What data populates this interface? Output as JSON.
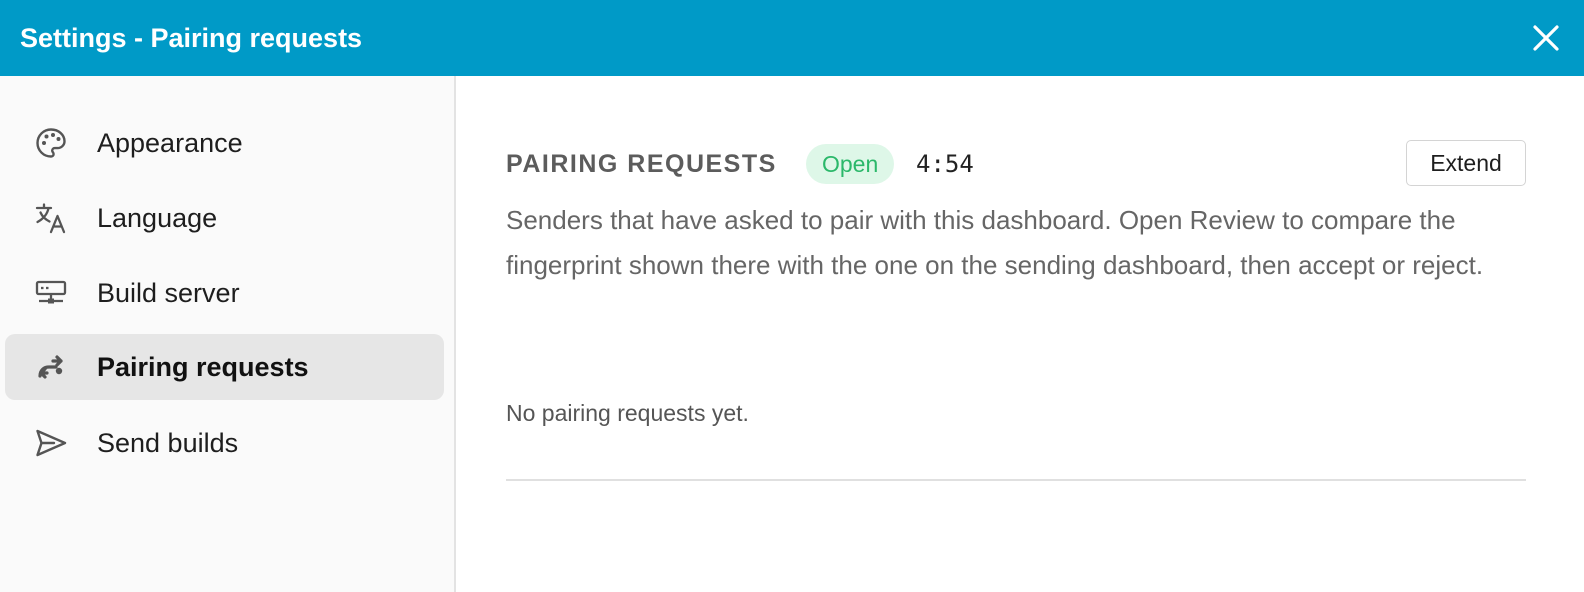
{
  "window": {
    "title": "Settings - Pairing requests",
    "close_icon": "close-icon",
    "titlebar_color": "#009ac7"
  },
  "sidebar": {
    "items": [
      {
        "id": "appearance",
        "label": "Appearance",
        "icon": "palette-icon",
        "active": false
      },
      {
        "id": "language",
        "label": "Language",
        "icon": "translate-icon",
        "active": false
      },
      {
        "id": "build-server",
        "label": "Build server",
        "icon": "server-icon",
        "active": false
      },
      {
        "id": "pairing-requests",
        "label": "Pairing requests",
        "icon": "pairing-icon",
        "active": true
      },
      {
        "id": "send-builds",
        "label": "Send builds",
        "icon": "send-icon",
        "active": false
      }
    ]
  },
  "main": {
    "section_title": "PAIRING REQUESTS",
    "status": {
      "label": "Open",
      "color": "#2bb86a",
      "background": "#def7e8"
    },
    "timer": "4:54",
    "extend_label": "Extend",
    "description": "Senders that have asked to pair with this dashboard. Open Review to compare the fingerprint shown there with the one on the sending dashboard, then accept or reject.",
    "empty_state": "No pairing requests yet."
  }
}
